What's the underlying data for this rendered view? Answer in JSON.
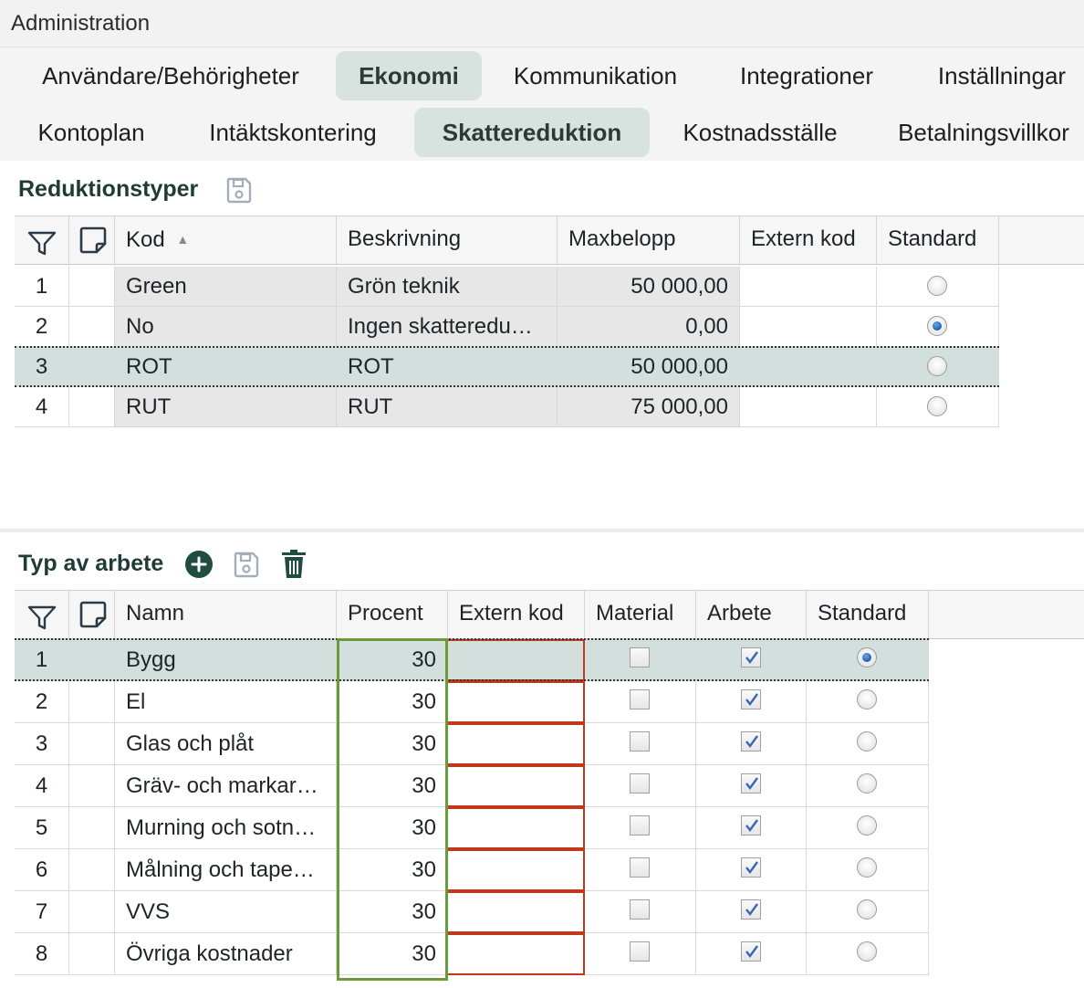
{
  "window": {
    "title": "Administration"
  },
  "main_tabs": [
    {
      "label": "Användare/Behörigheter",
      "active": false
    },
    {
      "label": "Ekonomi",
      "active": true
    },
    {
      "label": "Kommunikation",
      "active": false
    },
    {
      "label": "Integrationer",
      "active": false
    },
    {
      "label": "Inställningar",
      "active": false
    }
  ],
  "sub_tabs": [
    {
      "label": "Kontoplan",
      "active": false
    },
    {
      "label": "Intäktskontering",
      "active": false
    },
    {
      "label": "Skattereduktion",
      "active": true
    },
    {
      "label": "Kostnadsställe",
      "active": false
    },
    {
      "label": "Betalningsvillkor",
      "active": false
    }
  ],
  "reduktionstyper": {
    "title": "Reduktionstyper",
    "columns": {
      "kod": "Kod",
      "beskrivning": "Beskrivning",
      "maxbelopp": "Maxbelopp",
      "extern_kod": "Extern kod",
      "standard": "Standard"
    },
    "sort_indicator": "▲",
    "rows": [
      {
        "nr": "1",
        "kod": "Green",
        "beskrivning": "Grön teknik",
        "maxbelopp": "50 000,00",
        "extern_kod": "",
        "standard": false
      },
      {
        "nr": "2",
        "kod": "No",
        "beskrivning": "Ingen skatteredu…",
        "maxbelopp": "0,00",
        "extern_kod": "",
        "standard": true
      },
      {
        "nr": "3",
        "kod": "ROT",
        "beskrivning": "ROT",
        "maxbelopp": "50 000,00",
        "extern_kod": "",
        "standard": false
      },
      {
        "nr": "4",
        "kod": "RUT",
        "beskrivning": "RUT",
        "maxbelopp": "75 000,00",
        "extern_kod": "",
        "standard": false
      }
    ],
    "selected_row": 3
  },
  "typ_av_arbete": {
    "title": "Typ av arbete",
    "columns": {
      "namn": "Namn",
      "procent": "Procent",
      "extern_kod": "Extern kod",
      "material": "Material",
      "arbete": "Arbete",
      "standard": "Standard"
    },
    "rows": [
      {
        "nr": "1",
        "namn": "Bygg",
        "procent": "30",
        "extern_kod": "",
        "material": false,
        "arbete": true,
        "standard": true
      },
      {
        "nr": "2",
        "namn": "El",
        "procent": "30",
        "extern_kod": "",
        "material": false,
        "arbete": true,
        "standard": false
      },
      {
        "nr": "3",
        "namn": "Glas och plåt",
        "procent": "30",
        "extern_kod": "",
        "material": false,
        "arbete": true,
        "standard": false
      },
      {
        "nr": "4",
        "namn": "Gräv- och markar…",
        "procent": "30",
        "extern_kod": "",
        "material": false,
        "arbete": true,
        "standard": false
      },
      {
        "nr": "5",
        "namn": "Murning och sotn…",
        "procent": "30",
        "extern_kod": "",
        "material": false,
        "arbete": true,
        "standard": false
      },
      {
        "nr": "6",
        "namn": "Målning och tape…",
        "procent": "30",
        "extern_kod": "",
        "material": false,
        "arbete": true,
        "standard": false
      },
      {
        "nr": "7",
        "namn": "VVS",
        "procent": "30",
        "extern_kod": "",
        "material": false,
        "arbete": true,
        "standard": false
      },
      {
        "nr": "8",
        "namn": "Övriga kostnader",
        "procent": "30",
        "extern_kod": "",
        "material": false,
        "arbete": true,
        "standard": false
      }
    ],
    "selected_row": 1
  },
  "colors": {
    "accent": "#1f4d40",
    "selected_row": "#d3dfdc",
    "procent_highlight": "#6a9a3a",
    "extern_kod_highlight": "#c0391b"
  },
  "icons": [
    "save-icon",
    "add-icon",
    "delete-icon",
    "filter-icon",
    "note-icon"
  ]
}
